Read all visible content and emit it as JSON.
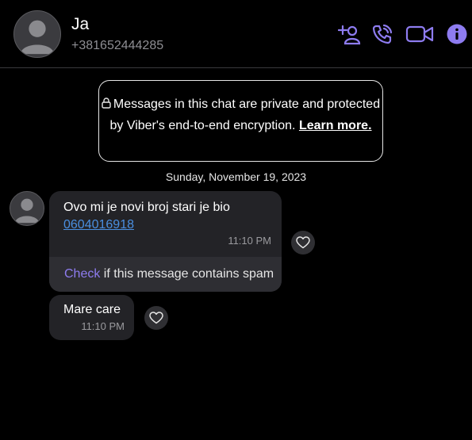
{
  "header": {
    "contact_name": "Ja",
    "contact_phone": "+381652444285"
  },
  "notice": {
    "text": "Messages in this chat are private and protected by Viber's end-to-end encryption.",
    "link": "Learn more."
  },
  "date_separator": "Sunday, November 19, 2023",
  "messages": [
    {
      "text": "Ovo mi je novi broj stari je bio",
      "link": "0604016918",
      "time": "11:10 PM",
      "spam_check": "Check",
      "spam_text": " if this message contains spam"
    },
    {
      "text": "Mare care",
      "time": "11:10 PM"
    }
  ],
  "colors": {
    "accent": "#8e7cf0",
    "link": "#4a8fe0",
    "bubble": "#232327",
    "background": "#000000"
  },
  "icons": [
    "add-participant-icon",
    "voice-call-icon",
    "video-call-icon",
    "info-icon",
    "lock-icon",
    "heart-icon"
  ]
}
